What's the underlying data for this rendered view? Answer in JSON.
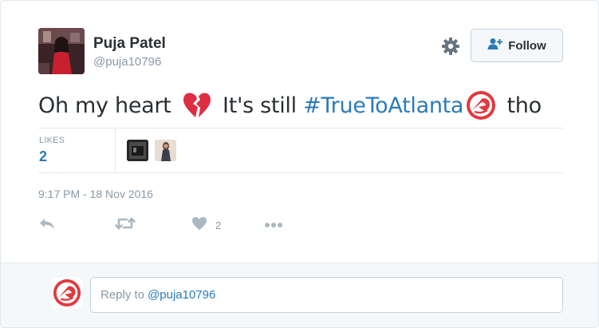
{
  "user": {
    "name": "Puja Patel",
    "handle": "@puja10796"
  },
  "follow_button": {
    "label": "Follow"
  },
  "tweet": {
    "text_before": "Oh my heart ",
    "emoji_1": "broken-heart",
    "text_middle": " It's still ",
    "hashtag": "#TrueToAtlanta",
    "emoji_2": "atlanta-hawks-logo",
    "text_after": " tho"
  },
  "stats": {
    "likes_label": "LIKES",
    "likes_count": "2"
  },
  "timestamp": "9:17 PM - 18 Nov 2016",
  "actions": {
    "like_count": "2"
  },
  "reply": {
    "prefix": "Reply to",
    "mention": "@puja10796"
  },
  "colors": {
    "link": "#2b7bb9",
    "muted": "#8899a6",
    "text": "#292f33",
    "hawks_red": "#e03a3e",
    "heart": "#dd2e44"
  }
}
